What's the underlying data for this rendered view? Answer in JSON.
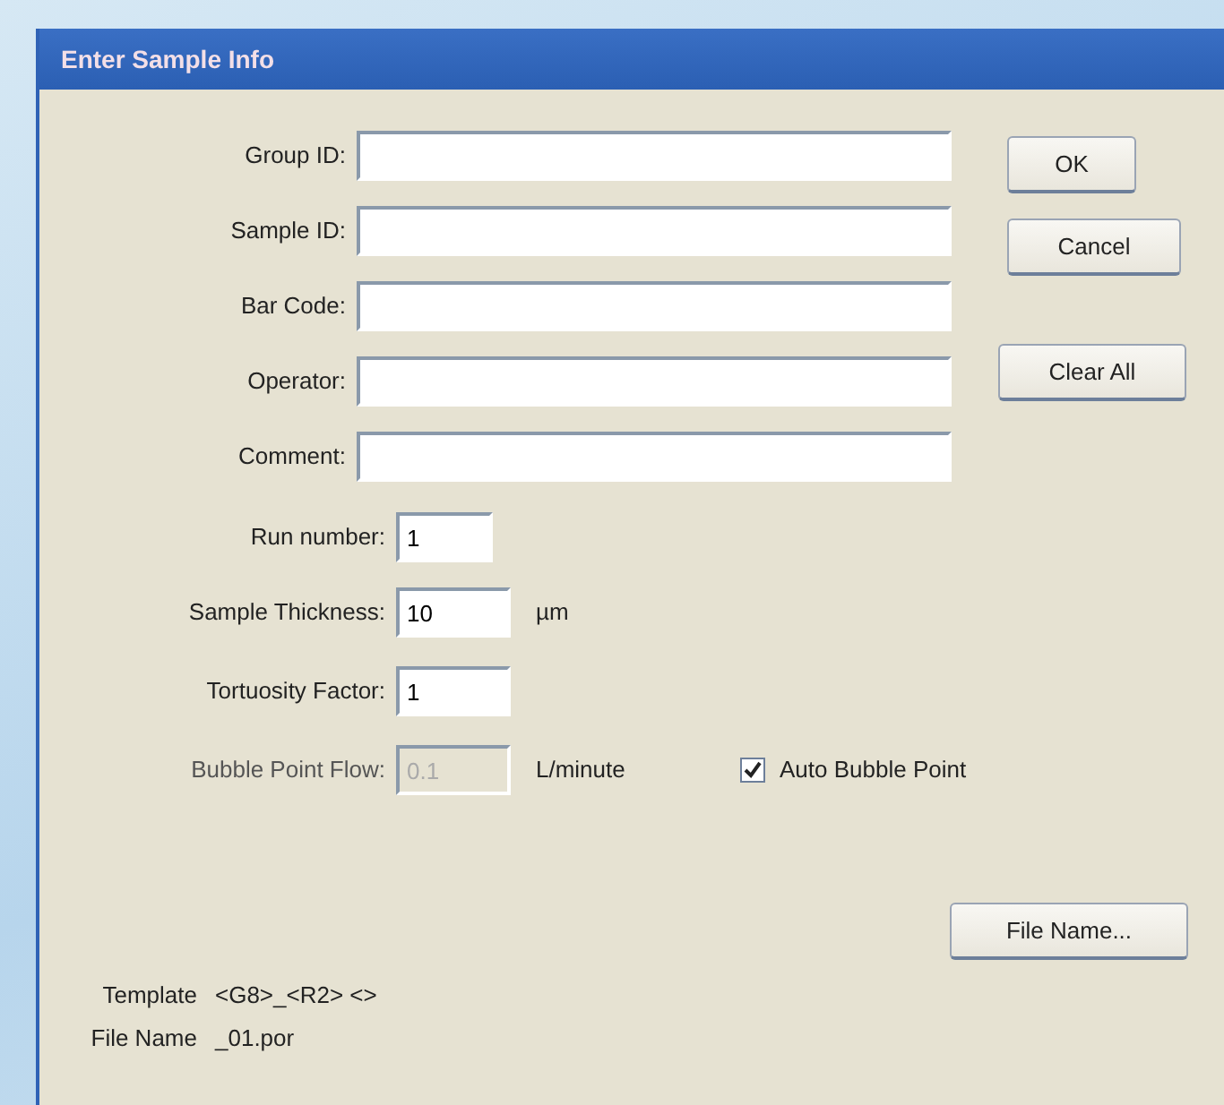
{
  "window": {
    "title": "Enter Sample Info"
  },
  "text_fields": [
    {
      "label": "Group ID:"
    },
    {
      "label": "Sample ID:"
    },
    {
      "label": "Bar Code:"
    },
    {
      "label": "Operator:"
    },
    {
      "label": "Comment:"
    }
  ],
  "side_buttons": [
    "OK",
    "Cancel",
    "Clear All"
  ],
  "number_fields": [
    {
      "kind": "short",
      "label": "Run number:",
      "value": "1",
      "disabled": false
    },
    {
      "kind": "medium",
      "label": "Sample Thickness:",
      "value": "10",
      "unit": "µm",
      "disabled": false
    },
    {
      "kind": "medium",
      "label": "Tortuosity Factor:",
      "value": "1",
      "disabled": false
    },
    {
      "kind": "medium",
      "label": "Bubble Point Flow:",
      "value": "0.1",
      "unit": "L/minute",
      "disabled": true
    }
  ],
  "auto_bubble_point": {
    "label": "Auto Bubble Point",
    "checked": true
  },
  "file_name_button": "File Name...",
  "info": [
    {
      "label": "Template",
      "value": "<G8>_<R2> <>"
    },
    {
      "label": "File Name",
      "value": "_01.por"
    }
  ]
}
